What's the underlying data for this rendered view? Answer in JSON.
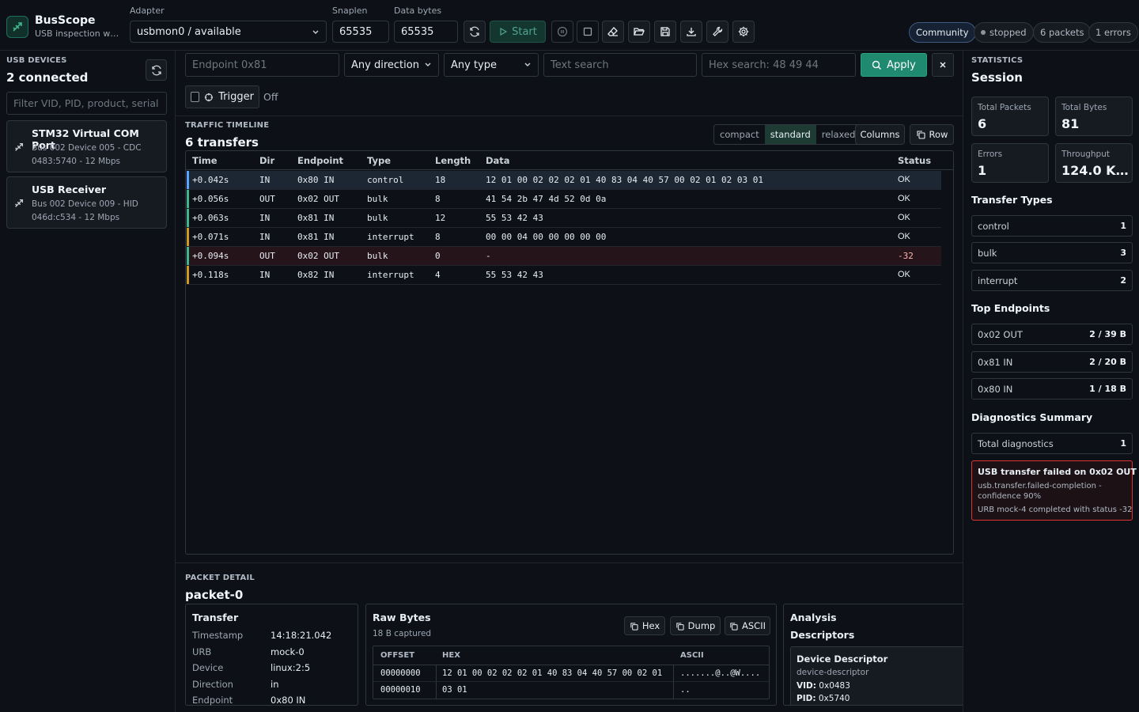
{
  "app": {
    "title": "BusScope",
    "subtitle": "USB inspection wor..."
  },
  "toolbar": {
    "adapter_label": "Adapter",
    "adapter_value": "usbmon0 / available",
    "snaplen_label": "Snaplen",
    "snaplen_value": "65535",
    "databytes_label": "Data bytes",
    "databytes_value": "65535",
    "start_label": "Start",
    "edition": "Community",
    "state": "stopped",
    "packets": "6 packets",
    "errors": "1 errors"
  },
  "devices": {
    "kicker": "USB DEVICES",
    "title": "2 connected",
    "filter_placeholder": "Filter VID, PID, product, serial",
    "items": [
      {
        "name": "STM32 Virtual COM Port",
        "line1": "Bus 002 Device 005 - CDC",
        "line2": "0483:5740 - 12 Mbps"
      },
      {
        "name": "USB Receiver",
        "line1": "Bus 002 Device 009 - HID",
        "line2": "046d:c534 - 12 Mbps"
      }
    ]
  },
  "filters": {
    "endpoint_placeholder": "Endpoint 0x81",
    "direction": "Any direction",
    "type": "Any type",
    "text_placeholder": "Text search",
    "hex_placeholder": "Hex search: 48 49 44",
    "apply": "Apply",
    "trigger_label": "Trigger",
    "trigger_state": "Off"
  },
  "timeline": {
    "kicker": "TRAFFIC TIMELINE",
    "title": "6 transfers",
    "density": [
      "compact",
      "standard",
      "relaxed"
    ],
    "columns_btn": "Columns",
    "row_btn": "Row",
    "headers": [
      "Time",
      "Dir",
      "Endpoint",
      "Type",
      "Length",
      "Data",
      "Status"
    ],
    "rows": [
      {
        "time": "+0.042s",
        "dir": "IN",
        "ep": "0x80 IN",
        "type": "control",
        "len": "18",
        "data": "12 01 00 02 02 02 01 40 83 04 40 57 00 02 01 02 03 01",
        "status": "OK",
        "color": "#58a6ff"
      },
      {
        "time": "+0.056s",
        "dir": "OUT",
        "ep": "0x02 OUT",
        "type": "bulk",
        "len": "8",
        "data": "41 54 2b 47 4d 52 0d 0a",
        "status": "OK",
        "color": "#3fb68b"
      },
      {
        "time": "+0.063s",
        "dir": "IN",
        "ep": "0x81 IN",
        "type": "bulk",
        "len": "12",
        "data": "55 53 42 43",
        "status": "OK",
        "color": "#3fb68b"
      },
      {
        "time": "+0.071s",
        "dir": "IN",
        "ep": "0x81 IN",
        "type": "interrupt",
        "len": "8",
        "data": "00 00 04 00 00 00 00 00",
        "status": "OK",
        "color": "#d29922"
      },
      {
        "time": "+0.094s",
        "dir": "OUT",
        "ep": "0x02 OUT",
        "type": "bulk",
        "len": "0",
        "data": "-",
        "status": "-32",
        "color": "#3fb68b"
      },
      {
        "time": "+0.118s",
        "dir": "IN",
        "ep": "0x82 IN",
        "type": "interrupt",
        "len": "4",
        "data": "55 53 42 43",
        "status": "OK",
        "color": "#d29922"
      }
    ]
  },
  "detail": {
    "kicker": "PACKET DETAIL",
    "title": "packet-0",
    "transfer": {
      "heading": "Transfer",
      "fields": [
        {
          "k": "Timestamp",
          "v": "14:18:21.042"
        },
        {
          "k": "URB",
          "v": "mock-0"
        },
        {
          "k": "Device",
          "v": "linux:2:5"
        },
        {
          "k": "Direction",
          "v": "in"
        },
        {
          "k": "Endpoint",
          "v": "0x80 IN"
        }
      ]
    },
    "raw": {
      "heading": "Raw Bytes",
      "captured": "18 B captured",
      "btn_hex": "Hex",
      "btn_dump": "Dump",
      "btn_ascii": "ASCII",
      "col_offset": "OFFSET",
      "col_hex": "HEX",
      "col_ascii": "ASCII",
      "lines": [
        {
          "offset": "00000000",
          "hex": "12 01 00 02 02 02 01 40 83 04 40 57 00 02 01",
          "ascii": ".......@..@W...."
        },
        {
          "offset": "00000010",
          "hex": "03 01",
          "ascii": ".."
        }
      ]
    },
    "analysis": {
      "heading": "Analysis",
      "sub": "Descriptors",
      "card_title": "Device Descriptor",
      "card_kind": "device-descriptor",
      "vid_k": "VID:",
      "vid_v": "0x0483",
      "pid_k": "PID:",
      "pid_v": "0x5740"
    }
  },
  "stats": {
    "kicker": "STATISTICS",
    "title": "Session",
    "cards": [
      {
        "label": "Total Packets",
        "value": "6"
      },
      {
        "label": "Total Bytes",
        "value": "81"
      },
      {
        "label": "Errors",
        "value": "1"
      },
      {
        "label": "Throughput",
        "value": "124.0 Kb..."
      }
    ],
    "types_heading": "Transfer Types",
    "types": [
      {
        "label": "control",
        "value": "1"
      },
      {
        "label": "bulk",
        "value": "3"
      },
      {
        "label": "interrupt",
        "value": "2"
      }
    ],
    "endpoints_heading": "Top Endpoints",
    "endpoints": [
      {
        "label": "0x02 OUT",
        "value": "2 / 39 B"
      },
      {
        "label": "0x81 IN",
        "value": "2 / 20 B"
      },
      {
        "label": "0x80 IN",
        "value": "1 / 18 B"
      }
    ],
    "diag_heading": "Diagnostics Summary",
    "diag_total_label": "Total diagnostics",
    "diag_total_value": "1",
    "alert_title": "USB transfer failed on 0x02 OUT",
    "alert_line1": "usb.transfer.failed-completion -",
    "alert_line2": "confidence 90%",
    "alert_line3": "URB mock-4 completed with status -32"
  },
  "colors": {
    "accent": "#1f8a70",
    "error": "#f85149",
    "warning": "#d29922",
    "info": "#58a6ff"
  }
}
